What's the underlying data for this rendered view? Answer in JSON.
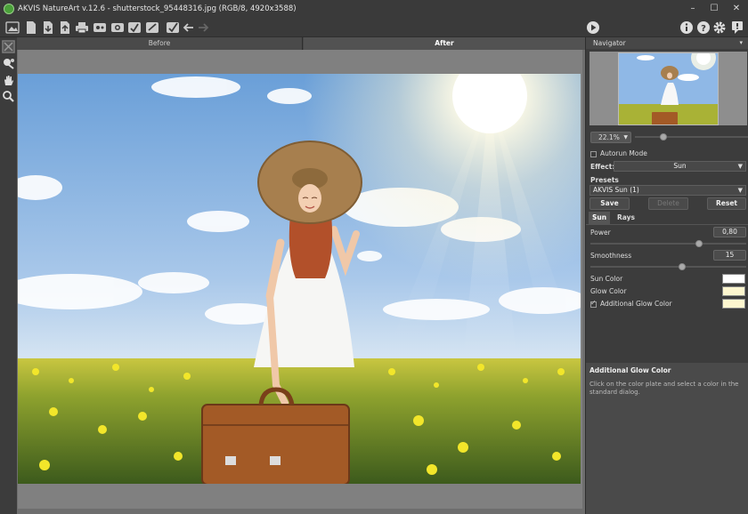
{
  "window": {
    "title": "AKVIS NatureArt v.12.6 - shutterstock_95448316.jpg (RGB/8, 4920x3588)",
    "minimize": "–",
    "maximize": "☐",
    "close": "✕"
  },
  "toolbar": {
    "icons": [
      "open-image-icon",
      "new-file-icon",
      "save-icon",
      "export-icon",
      "print-icon",
      "share-icon",
      "settings-icon",
      "batch-icon",
      "presets-icon",
      "plugin-icon",
      "undo-icon",
      "redo-icon"
    ],
    "right_icons": [
      "run-icon",
      "info-icon",
      "help-icon",
      "preferences-icon",
      "notifications-icon"
    ]
  },
  "tabs": {
    "before": "Before",
    "after": "After"
  },
  "navigator": {
    "title": "Navigator",
    "zoom": "22.1%"
  },
  "settings": {
    "autorun_label": "Autorun Mode",
    "autorun_checked": false,
    "effect_label": "Effect:",
    "effect_value": "Sun",
    "presets_label": "Presets",
    "preset_value": "AKVIS Sun (1)",
    "save": "Save",
    "delete": "Delete",
    "reset": "Reset",
    "subtab_sun": "Sun",
    "subtab_rays": "Rays",
    "power_label": "Power",
    "power_value": "0,80",
    "smoothness_label": "Smoothness",
    "smoothness_value": "15",
    "sun_color_label": "Sun Color",
    "glow_color_label": "Glow Color",
    "additional_glow_label": "Additional Glow Color",
    "additional_glow_checked": true,
    "colors": {
      "sun": "#ffffff",
      "glow": "#fdf6cf",
      "additional_glow": "#fdf6cf"
    }
  },
  "help": {
    "title": "Additional Glow Color",
    "text": "Click on the color plate and select a color in the standard dialog."
  }
}
